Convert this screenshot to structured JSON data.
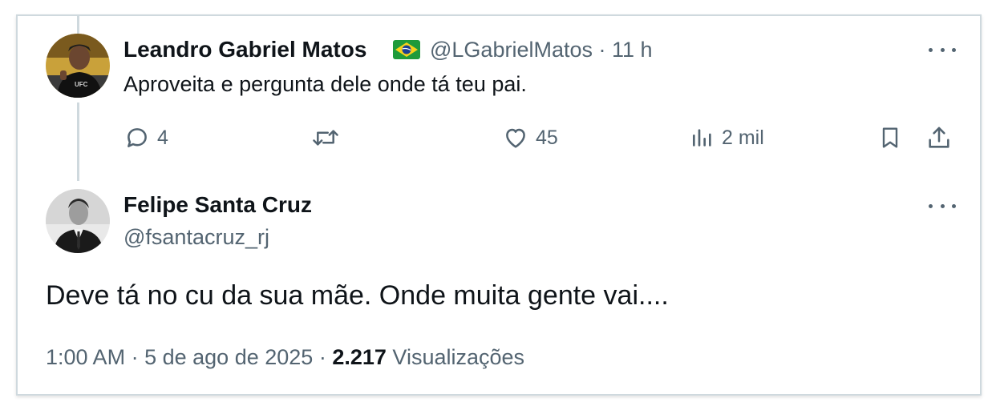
{
  "reply": {
    "author_name": "Leandro Gabriel Matos",
    "author_badge": "brazil-flag-icon",
    "handle": "@LGabrielMatos",
    "separator": "·",
    "time": "11 h",
    "text": "Aproveita e pergunta dele onde tá teu pai.",
    "actions": {
      "replies": "4",
      "reposts": "",
      "likes": "45",
      "views": "2 mil"
    }
  },
  "main": {
    "author_name": "Felipe Santa Cruz",
    "handle": "@fsantacruz_rj",
    "text": "Deve tá no cu da sua mãe. Onde muita gente vai....",
    "time": "1:00 AM",
    "date": "5 de ago de 2025",
    "separator": "·",
    "views_count": "2.217",
    "views_label": "Visualizações"
  },
  "colors": {
    "text_primary": "#0f1419",
    "text_secondary": "#536471",
    "border": "#cfd9de"
  },
  "icons": [
    "reply-icon",
    "repost-icon",
    "like-icon",
    "views-icon",
    "bookmark-icon",
    "share-icon",
    "more-icon"
  ]
}
